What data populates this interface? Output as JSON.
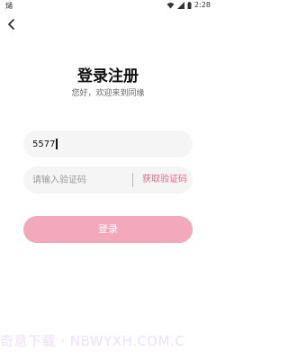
{
  "status_bar": {
    "left_text": "熥",
    "time": "2:28",
    "icons": [
      "wifi-icon",
      "signal-icon",
      "battery-icon"
    ]
  },
  "header": {
    "back_icon": "chevron-left-icon"
  },
  "page": {
    "title": "登录注册",
    "subtitle": "您好，欢迎来到同缘"
  },
  "form": {
    "phone_value": "5577",
    "code_value": "",
    "code_placeholder": "请输入验证码",
    "get_code_label": "获取验证码",
    "submit_label": "登录"
  },
  "watermark": "奇意下载 · NBWYXH.COM.C",
  "colors": {
    "accent": "#e0678a",
    "button": "#f4a8bc",
    "field_bg": "#f5f5f5"
  }
}
